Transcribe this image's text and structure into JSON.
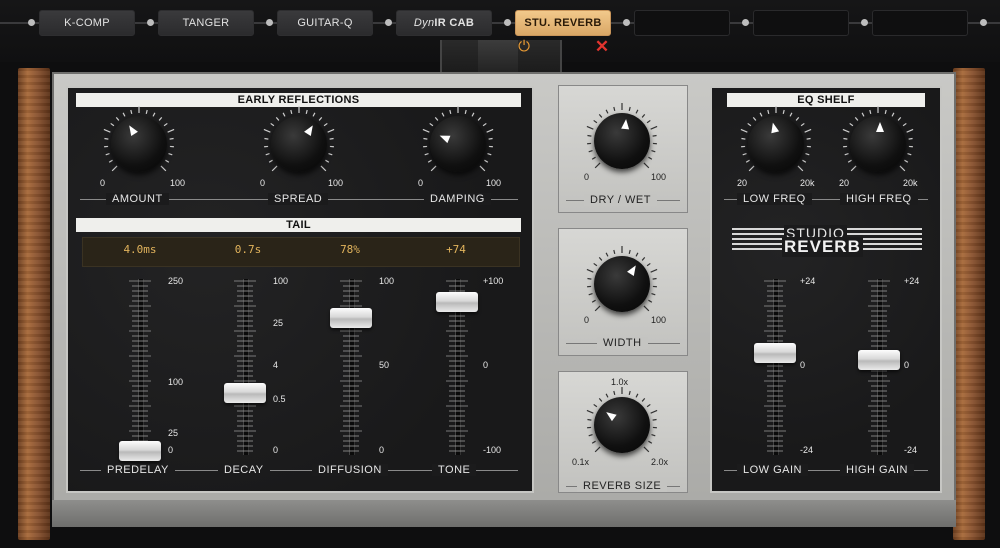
{
  "chain": {
    "slots": [
      {
        "label": "K-COMP"
      },
      {
        "label": "TANGER"
      },
      {
        "label": "GUITAR-Q"
      },
      {
        "label_prefix": "Dyn",
        "label_main": "IR CAB"
      },
      {
        "label": "STU. REVERB",
        "active": true
      },
      {
        "label": ""
      },
      {
        "label": ""
      },
      {
        "label": ""
      }
    ],
    "power_icon": "power-icon",
    "close_icon": "close-icon"
  },
  "early_reflections": {
    "title": "EARLY REFLECTIONS",
    "knobs": [
      {
        "label": "AMOUNT",
        "min": "0",
        "max": "100",
        "value_fraction": 0.38
      },
      {
        "label": "SPREAD",
        "min": "0",
        "max": "100",
        "value_fraction": 0.62
      },
      {
        "label": "DAMPING",
        "min": "0",
        "max": "100",
        "value_fraction": 0.25
      }
    ]
  },
  "tail": {
    "title": "TAIL",
    "readouts": [
      "4.0ms",
      "0.7s",
      "78%",
      "+74"
    ],
    "faders": [
      {
        "label": "PREDELAY",
        "scale": [
          "250",
          "100",
          "25",
          "0"
        ],
        "value_fraction": 0.02
      },
      {
        "label": "DECAY",
        "scale": [
          "100",
          "25",
          "4",
          "0.5",
          "0"
        ],
        "value_fraction": 0.35
      },
      {
        "label": "DIFFUSION",
        "scale": [
          "100",
          "50",
          "0"
        ],
        "value_fraction": 0.78
      },
      {
        "label": "TONE",
        "scale": [
          "+100",
          "0",
          "-100"
        ],
        "value_fraction": 0.87
      }
    ]
  },
  "center": {
    "knobs": [
      {
        "label": "DRY / WET",
        "min": "0",
        "max": "100",
        "value_fraction": 0.52
      },
      {
        "label": "WIDTH",
        "min": "0",
        "max": "100",
        "value_fraction": 0.62
      },
      {
        "label": "REVERB SIZE",
        "min": "0.1x",
        "max": "2.0x",
        "mid": "1.0x",
        "value_fraction": 0.3
      }
    ]
  },
  "eq_shelf": {
    "title": "EQ SHELF",
    "knobs": [
      {
        "label": "LOW FREQ",
        "min": "20",
        "max": "20k",
        "value_fraction": 0.45
      },
      {
        "label": "HIGH FREQ",
        "min": "20",
        "max": "20k",
        "value_fraction": 0.5
      }
    ],
    "logo": {
      "line1": "STUDIO",
      "line2": "REVERB"
    },
    "faders": [
      {
        "label": "LOW GAIN",
        "scale": [
          "+24",
          "0",
          "-24"
        ],
        "value_fraction": 0.58
      },
      {
        "label": "HIGH GAIN",
        "scale": [
          "+24",
          "0",
          "-24"
        ],
        "value_fraction": 0.54
      }
    ]
  }
}
